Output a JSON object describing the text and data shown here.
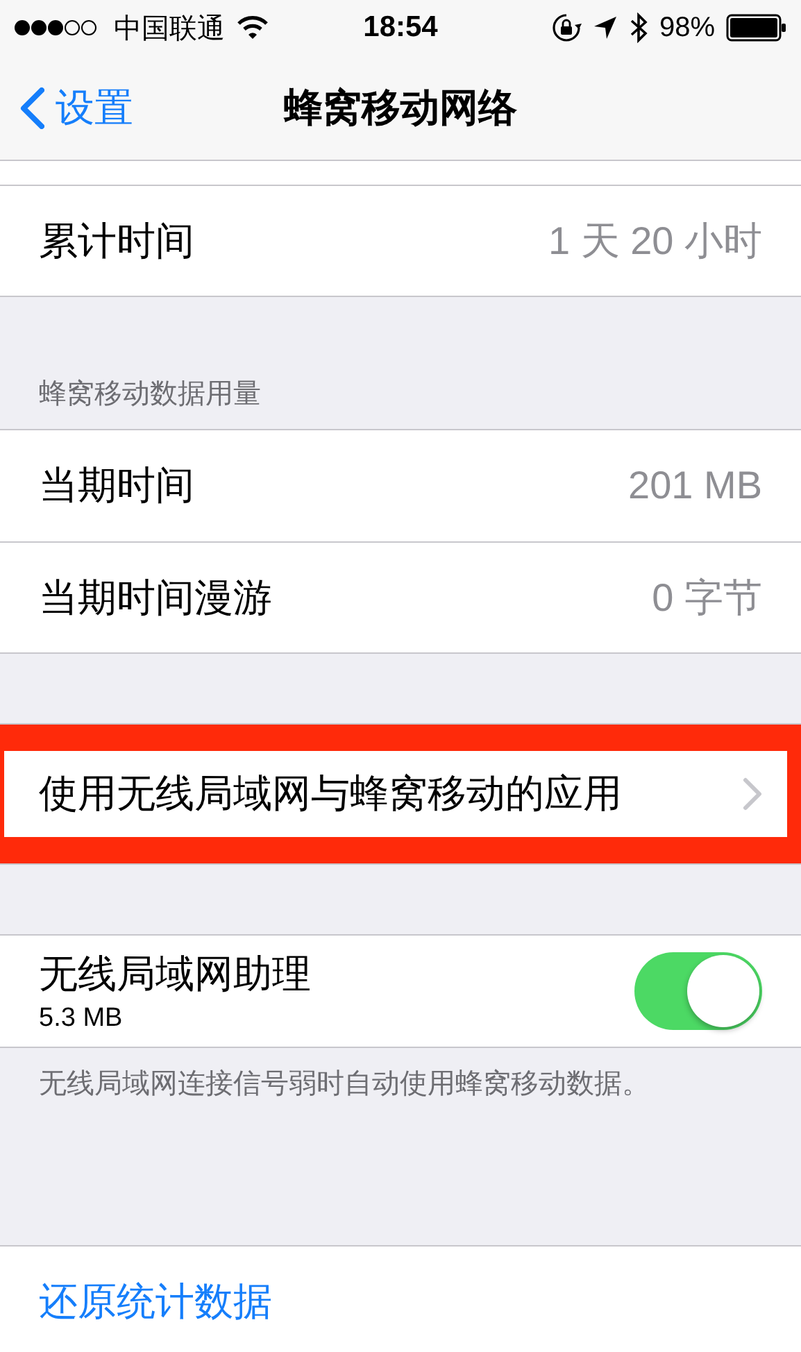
{
  "status_bar": {
    "carrier": "中国联通",
    "time": "18:54",
    "battery": "98%"
  },
  "nav": {
    "back": "设置",
    "title": "蜂窝移动网络"
  },
  "sections": [
    {
      "rows": [
        {
          "kind": "value",
          "label": "累计时间",
          "value": "1 天 20 小时"
        }
      ]
    },
    {
      "header": "蜂窝移动数据用量",
      "rows": [
        {
          "kind": "value",
          "label": "当期时间",
          "value": "201 MB"
        },
        {
          "kind": "value",
          "label": "当期时间漫游",
          "value": "0 字节"
        }
      ]
    },
    {
      "rows": [
        {
          "kind": "link",
          "label": "使用无线局域网与蜂窝移动的应用",
          "highlighted": true
        }
      ]
    },
    {
      "rows": [
        {
          "kind": "toggle",
          "label": "无线局域网助理",
          "detail": "5.3 MB",
          "on": true
        }
      ],
      "footer": "无线局域网连接信号弱时自动使用蜂窝移动数据。"
    },
    {
      "rows": [
        {
          "kind": "action",
          "label": "还原统计数据"
        }
      ]
    }
  ]
}
